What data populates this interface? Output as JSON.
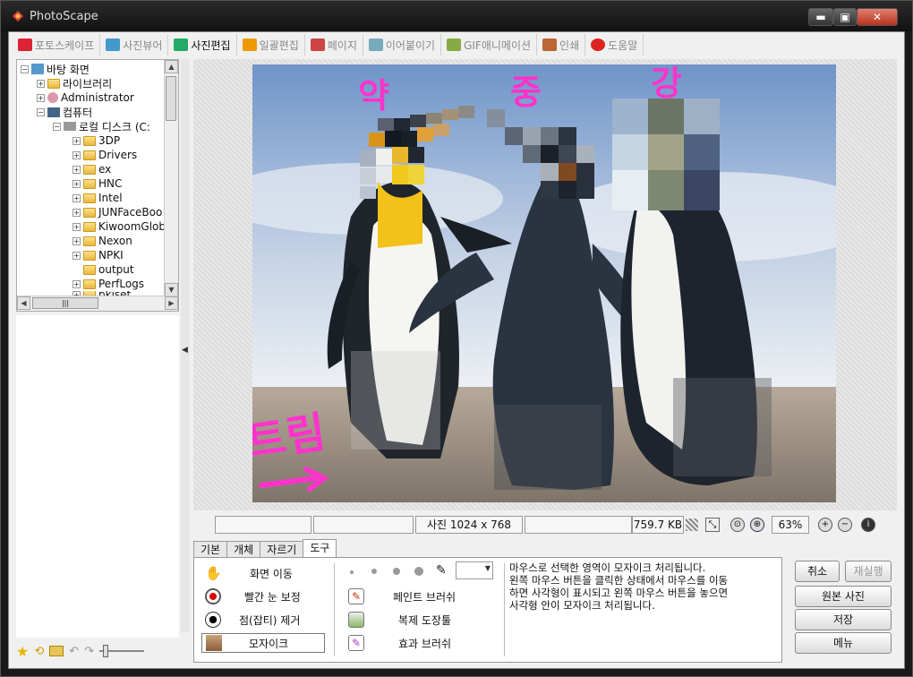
{
  "window": {
    "title": "PhotoScape"
  },
  "controls": {
    "minimize": "▬",
    "maximize": "▣",
    "close": "✕"
  },
  "tabs": [
    {
      "label": "포토스케이프",
      "color": "#d23"
    },
    {
      "label": "사진뷰어",
      "color": "#49c"
    },
    {
      "label": "사진편집",
      "color": "#2a6"
    },
    {
      "label": "일괄편집",
      "color": "#e90"
    },
    {
      "label": "페이지",
      "color": "#c44"
    },
    {
      "label": "이어붙이기",
      "color": "#7ab"
    },
    {
      "label": "GIF애니메이션",
      "color": "#8a4"
    },
    {
      "label": "인쇄",
      "color": "#b63"
    },
    {
      "label": "도움말",
      "color": "#d22"
    }
  ],
  "tree": {
    "desktop": "바탕 화면",
    "library": "라이브러리",
    "admin": "Administrator",
    "computer": "컴퓨터",
    "disk": "로컬 디스크 (C:",
    "folders": [
      "3DP",
      "Drivers",
      "ex",
      "HNC",
      "Intel",
      "JUNFaceBoo",
      "KiwoomGlob",
      "Nexon",
      "NPKI",
      "output",
      "PerfLogs",
      "pkiset"
    ],
    "hscroll_thumb": "|||"
  },
  "annotations": {
    "weak": "약",
    "medium": "중",
    "strong": "강",
    "scatter": "흐트림"
  },
  "status": {
    "dimensions": "사진 1024 x 768",
    "filesize": "759.7 KB",
    "zoom": "63%"
  },
  "edit_tabs": [
    "기본",
    "개체",
    "자르기",
    "도구"
  ],
  "tools": {
    "move": "화면 이동",
    "redeye": "빨간 눈 보정",
    "spot": "점(잡티) 제거",
    "mosaic": "모자이크",
    "paint": "페인트 브러쉬",
    "clone": "복제 도장툴",
    "effect": "효과 브러쉬"
  },
  "help_text": [
    "마우스로 선택한 영역이 모자이크 처리됩니다.",
    "왼쪽 마우스 버튼을 클릭한 상태에서 마우스를 이동",
    "하면 사각형이 표시되고 왼쪽 마우스 버튼을 놓으면",
    "사각형 안이 모자이크 처리됩니다."
  ],
  "actions": {
    "cancel": "취소",
    "redo": "재실행",
    "original": "원본 사진",
    "save": "저장",
    "menu": "메뉴"
  },
  "accent": "#ff33cc"
}
